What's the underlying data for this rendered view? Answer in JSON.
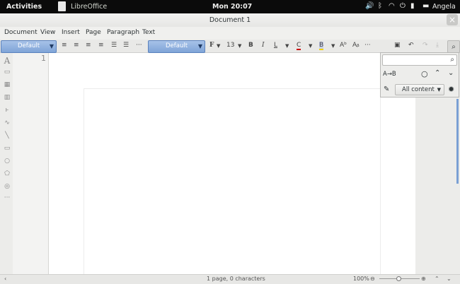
{
  "topbar": {
    "activities": "Activities",
    "app_name": "LibreOffice",
    "clock": "Mon 20:07",
    "user": "Angela",
    "tray_icons": [
      "volume-icon",
      "bluetooth-icon",
      "wifi-icon",
      "power-icon",
      "battery-icon",
      "chat-icon"
    ]
  },
  "window": {
    "title": "Document 1",
    "close_glyph": "×"
  },
  "menu": [
    "Document",
    "View",
    "Insert",
    "Page",
    "Paragraph",
    "Text"
  ],
  "toolbar": {
    "paragraph_style": "Default",
    "font_name": "Default",
    "font_glyph": "F",
    "font_size": "13",
    "bold": "B",
    "italic": "I",
    "underline": "L",
    "font_color": "C",
    "highlight": "B",
    "superscript": "Aᵇ",
    "subscript": "Aᵦ",
    "more": "···",
    "font_color_hex": "#cc0000",
    "highlight_hex": "#f2d200"
  },
  "ruler": {
    "page_number": "1"
  },
  "find": {
    "replace_label": "A→B",
    "scope": "All content"
  },
  "status": {
    "page_info": "1 page, 0 characters",
    "zoom": "100%"
  }
}
